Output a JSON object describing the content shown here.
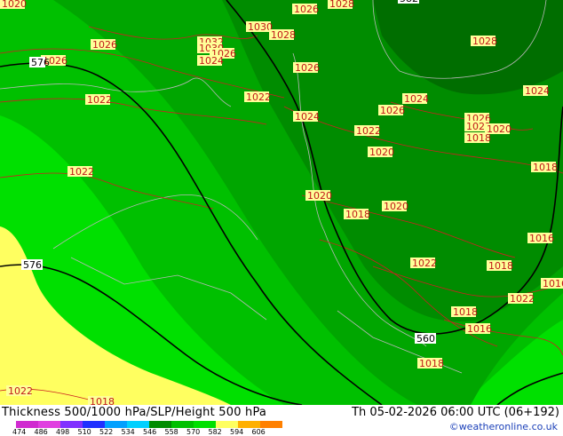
{
  "map": {
    "isobar_labels": [
      "1020",
      "1026",
      "1028",
      "1026",
      "1030",
      "1032",
      "1030",
      "1026",
      "1024",
      "1028",
      "1026",
      "1028",
      "1026",
      "1022",
      "1022",
      "1022",
      "1024",
      "1026",
      "1024",
      "1024",
      "1022",
      "1026",
      "1022",
      "1022",
      "1020",
      "1018",
      "1020",
      "1018",
      "1018",
      "1020",
      "1018",
      "1022",
      "1018",
      "1016",
      "1016",
      "1018",
      "1016",
      "1018",
      "1022",
      "1020"
    ],
    "thickness_labels": [
      "576",
      "560",
      "582",
      "576"
    ],
    "colors": {
      "dark_green": "#008c00",
      "mid_green": "#00a600",
      "green": "#00c000",
      "light_green": "#00e000",
      "yellow": "#ffff60",
      "isobar": "#cc2020",
      "height_contour": "#000000",
      "coastline": "#aaaaaa"
    }
  },
  "footer": {
    "title": "Thickness 500/1000 hPa/SLP/Height 500 hPa",
    "valid_time": "Th 05-02-2026 06:00 UTC (06+192)",
    "credit": "©weatheronline.co.uk",
    "scale_ticks": [
      "474",
      "486",
      "498",
      "510",
      "522",
      "534",
      "546",
      "558",
      "570",
      "582",
      "594",
      "606"
    ],
    "scale_colors": [
      "#d02bd0",
      "#e040e0",
      "#8030ff",
      "#2030ff",
      "#00a0ff",
      "#00d0ff",
      "#008c00",
      "#00c000",
      "#00e000",
      "#ffff60",
      "#ffb000",
      "#ff8000"
    ]
  }
}
